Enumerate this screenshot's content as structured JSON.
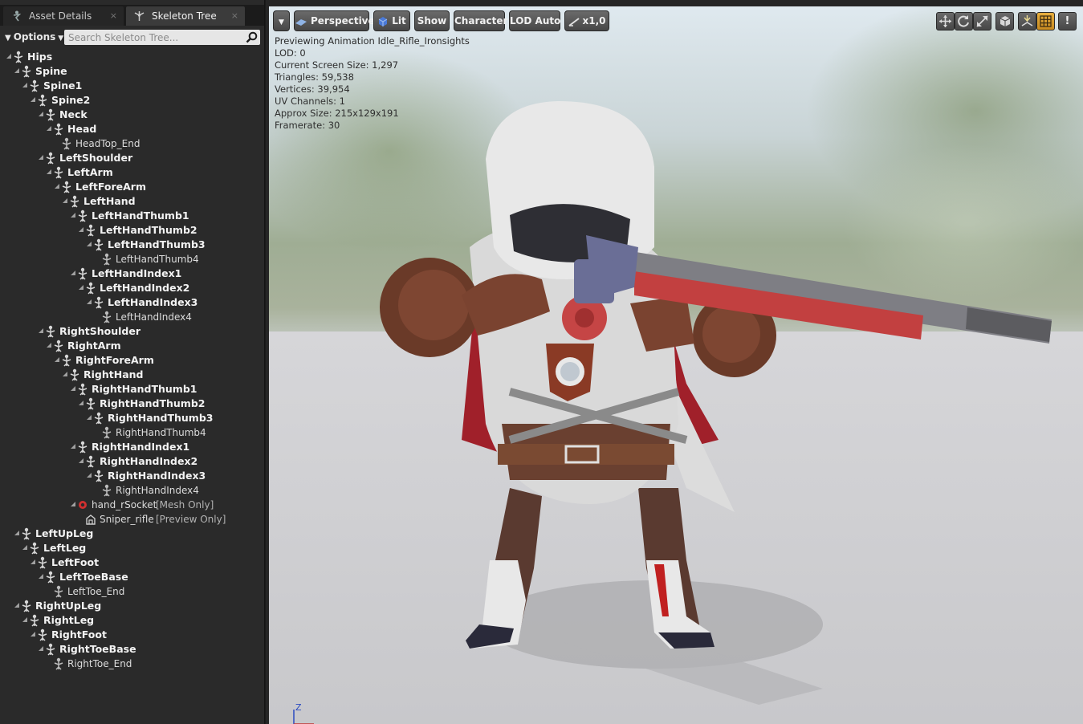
{
  "tabs": [
    {
      "label": "Asset Details",
      "close": "×",
      "icon": "asset-details-icon"
    },
    {
      "label": "Skeleton Tree",
      "close": "×",
      "icon": "skeleton-tree-icon"
    }
  ],
  "filter": {
    "options_label": "Options",
    "search_placeholder": "Search Skeleton Tree..."
  },
  "tree": [
    {
      "label": "Hips",
      "depth": 0,
      "type": "bone",
      "bold": true
    },
    {
      "label": "Spine",
      "depth": 1,
      "type": "bone",
      "bold": true
    },
    {
      "label": "Spine1",
      "depth": 2,
      "type": "bone",
      "bold": true
    },
    {
      "label": "Spine2",
      "depth": 3,
      "type": "bone",
      "bold": true
    },
    {
      "label": "Neck",
      "depth": 4,
      "type": "bone",
      "bold": true
    },
    {
      "label": "Head",
      "depth": 5,
      "type": "bone",
      "bold": true
    },
    {
      "label": "HeadTop_End",
      "depth": 6,
      "type": "bone",
      "bold": false
    },
    {
      "label": "LeftShoulder",
      "depth": 4,
      "type": "bone",
      "bold": true
    },
    {
      "label": "LeftArm",
      "depth": 5,
      "type": "bone",
      "bold": true
    },
    {
      "label": "LeftForeArm",
      "depth": 6,
      "type": "bone",
      "bold": true
    },
    {
      "label": "LeftHand",
      "depth": 7,
      "type": "bone",
      "bold": true
    },
    {
      "label": "LeftHandThumb1",
      "depth": 8,
      "type": "bone",
      "bold": true
    },
    {
      "label": "LeftHandThumb2",
      "depth": 9,
      "type": "bone",
      "bold": true
    },
    {
      "label": "LeftHandThumb3",
      "depth": 10,
      "type": "bone",
      "bold": true
    },
    {
      "label": "LeftHandThumb4",
      "depth": 11,
      "type": "bone",
      "bold": false
    },
    {
      "label": "LeftHandIndex1",
      "depth": 8,
      "type": "bone",
      "bold": true
    },
    {
      "label": "LeftHandIndex2",
      "depth": 9,
      "type": "bone",
      "bold": true
    },
    {
      "label": "LeftHandIndex3",
      "depth": 10,
      "type": "bone",
      "bold": true
    },
    {
      "label": "LeftHandIndex4",
      "depth": 11,
      "type": "bone",
      "bold": false
    },
    {
      "label": "RightShoulder",
      "depth": 4,
      "type": "bone",
      "bold": true
    },
    {
      "label": "RightArm",
      "depth": 5,
      "type": "bone",
      "bold": true
    },
    {
      "label": "RightForeArm",
      "depth": 6,
      "type": "bone",
      "bold": true
    },
    {
      "label": "RightHand",
      "depth": 7,
      "type": "bone",
      "bold": true
    },
    {
      "label": "RightHandThumb1",
      "depth": 8,
      "type": "bone",
      "bold": true
    },
    {
      "label": "RightHandThumb2",
      "depth": 9,
      "type": "bone",
      "bold": true
    },
    {
      "label": "RightHandThumb3",
      "depth": 10,
      "type": "bone",
      "bold": true
    },
    {
      "label": "RightHandThumb4",
      "depth": 11,
      "type": "bone",
      "bold": false
    },
    {
      "label": "RightHandIndex1",
      "depth": 8,
      "type": "bone",
      "bold": true
    },
    {
      "label": "RightHandIndex2",
      "depth": 9,
      "type": "bone",
      "bold": true
    },
    {
      "label": "RightHandIndex3",
      "depth": 10,
      "type": "bone",
      "bold": true
    },
    {
      "label": "RightHandIndex4",
      "depth": 11,
      "type": "bone",
      "bold": false
    },
    {
      "label": "hand_rSocket",
      "depth": 8,
      "type": "socket",
      "bold": false,
      "suffix": "[Mesh Only]"
    },
    {
      "label": "Sniper_rifle",
      "depth": 9,
      "type": "preview-mesh",
      "bold": false,
      "suffix": "[Preview Only]"
    },
    {
      "label": "LeftUpLeg",
      "depth": 1,
      "type": "bone",
      "bold": true
    },
    {
      "label": "LeftLeg",
      "depth": 2,
      "type": "bone",
      "bold": true
    },
    {
      "label": "LeftFoot",
      "depth": 3,
      "type": "bone",
      "bold": true
    },
    {
      "label": "LeftToeBase",
      "depth": 4,
      "type": "bone",
      "bold": true
    },
    {
      "label": "LeftToe_End",
      "depth": 5,
      "type": "bone",
      "bold": false
    },
    {
      "label": "RightUpLeg",
      "depth": 1,
      "type": "bone",
      "bold": true
    },
    {
      "label": "RightLeg",
      "depth": 2,
      "type": "bone",
      "bold": true
    },
    {
      "label": "RightFoot",
      "depth": 3,
      "type": "bone",
      "bold": true
    },
    {
      "label": "RightToeBase",
      "depth": 4,
      "type": "bone",
      "bold": true
    },
    {
      "label": "RightToe_End",
      "depth": 5,
      "type": "bone",
      "bold": false
    }
  ],
  "viewport": {
    "toolbar": {
      "perspective_label": "Perspective",
      "lit_label": "Lit",
      "show_label": "Show",
      "character_label": "Character",
      "lod_label": "LOD Auto",
      "speed_label": "x1,0"
    },
    "stats": {
      "preview": "Previewing Animation Idle_Rifle_Ironsights",
      "lod": "LOD: 0",
      "screen_size": "Current Screen Size: 1,297",
      "triangles": "Triangles: 59,538",
      "vertices": "Vertices: 39,954",
      "uv_channels": "UV Channels: 1",
      "approx_size": "Approx Size: 215x129x191",
      "framerate": "Framerate: 30"
    },
    "axis_label": "Z",
    "right_icons": [
      "transform-icon",
      "rotate-icon",
      "scale-icon",
      "coordinate-space-icon",
      "surface-snap-icon",
      "grid-snap-icon",
      "warning-icon"
    ],
    "warning_glyph": "!"
  },
  "colors": {
    "panel_bg": "#2a2a2a",
    "tab_active": "#3b3b3b",
    "search_bg": "#e6e6e6",
    "button_top": "#6a6a6a",
    "button_bottom": "#474747",
    "grid_snap_accent": "#e0a030",
    "socket_red": "#d03030"
  }
}
